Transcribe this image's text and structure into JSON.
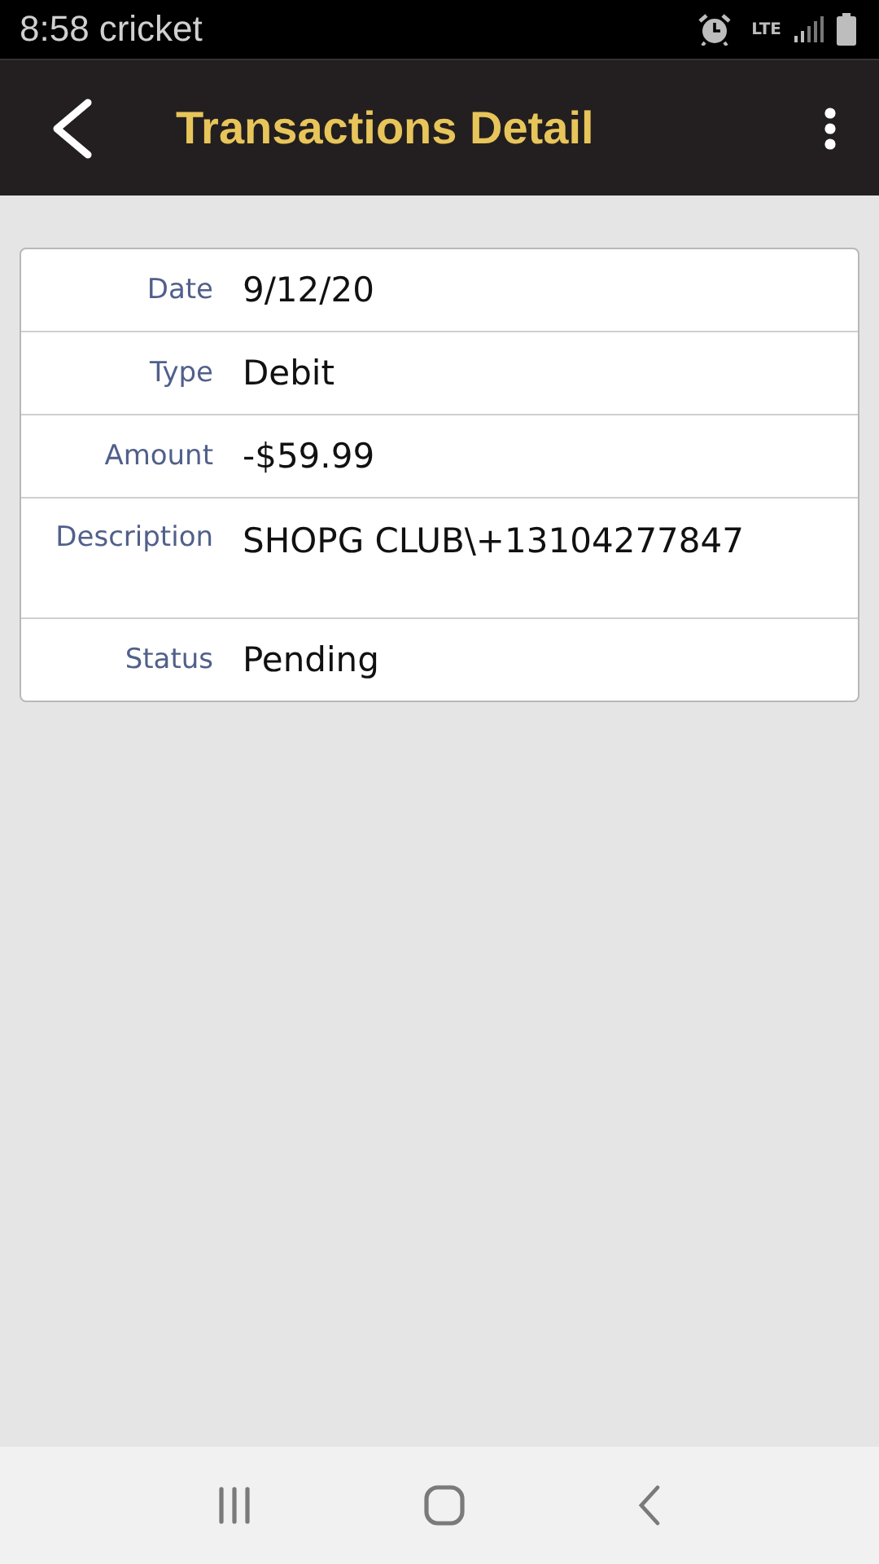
{
  "status_bar": {
    "time": "8:58",
    "carrier": "cricket",
    "network": "LTE"
  },
  "app_bar": {
    "title": "Transactions Detail"
  },
  "details": [
    {
      "label": "Date",
      "value": "9/12/20"
    },
    {
      "label": "Type",
      "value": "Debit"
    },
    {
      "label": "Amount",
      "value": "-$59.99"
    },
    {
      "label": "Description",
      "value": "SHOPG CLUB\\+13104277847",
      "kind": "tall"
    },
    {
      "label": "Status",
      "value": "Pending"
    }
  ]
}
